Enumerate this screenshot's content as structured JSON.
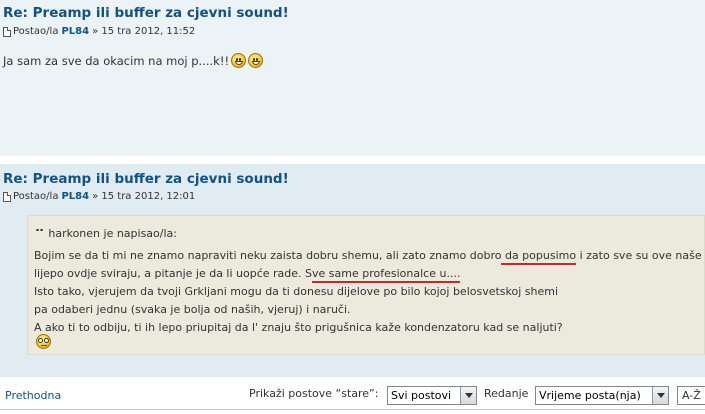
{
  "posts": [
    {
      "title": "Re: Preamp ili buffer za cjevni sound!",
      "posted_by_label": "Postao/la",
      "author": "PL84",
      "date": "» 15 tra 2012, 11:52",
      "body": "Ja sam za sve da okacim na moj p....k!!",
      "smileys": [
        "laughing-icon",
        "laughing-icon"
      ]
    },
    {
      "title": "Re: Preamp ili buffer za cjevni sound!",
      "posted_by_label": "Postao/la",
      "author": "PL84",
      "date": "» 15 tra 2012, 12:01",
      "quote": {
        "header": "harkonen je napisao/la:",
        "line1_a": "Bojim se da ti mi ne znamo napraviti neku zaista dobru shemu, ali zato znamo dobro",
        "line1_b": " da popusimo",
        "line1_c": " i zato sve su ove naše",
        "line2_a": "lijepo ovdje sviraju, a pitanje je da li uopće rade. S",
        "line2_b": "ve same profesionalce u....",
        "line3": "Isto tako, vjerujem da tvoji Grkljani mogu da ti donesu dijelove po bilo kojoj belosvetskoj shemi",
        "line4": "pa odaberi jednu (svaka je bolja od naših, vjeruj) i naruči.",
        "line5": "A ako ti to odbiju, ti ih lepo priupitaj da l' znaju što prigušnica kaže kondenzatoru kad se naljuti?",
        "smiley": "glasses-icon"
      }
    }
  ],
  "bottom": {
    "prev_label": "Prethodna",
    "show_posts_label": "Prikaži postove “stare”:",
    "show_posts_value": "Svi postovi",
    "sort_label": "Redanje",
    "sort_value": "Vrijeme posta(nja)",
    "order_value": "A-Ž"
  },
  "colors": {
    "title": "#105289",
    "post1_bg": "#ecf3f7",
    "post2_bg": "#e1ebf2",
    "quote_bg": "#ebeadd",
    "underline": "#c82828"
  }
}
